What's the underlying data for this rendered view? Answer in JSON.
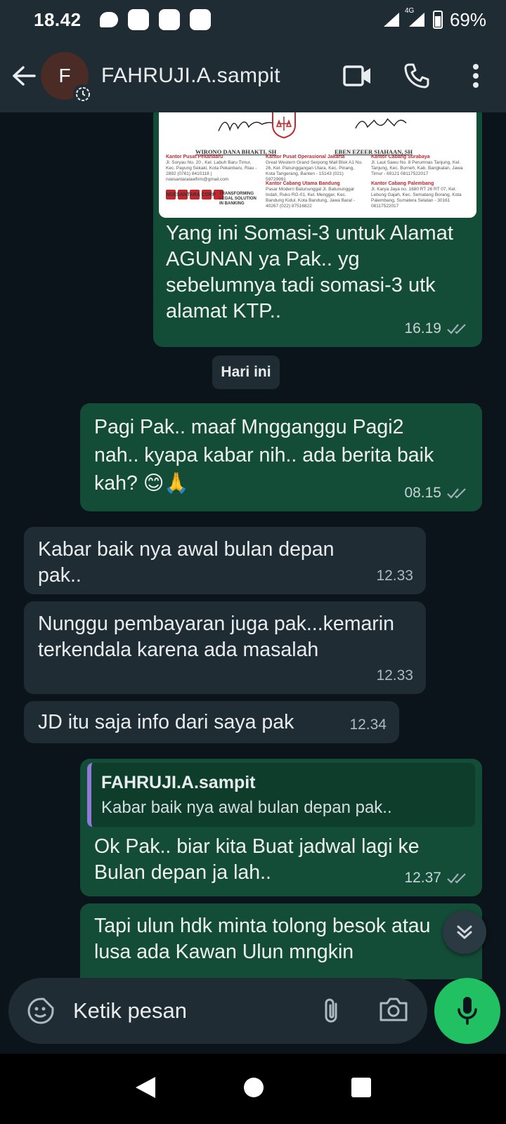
{
  "status": {
    "time": "18.42",
    "network": "4G",
    "battery": "69%"
  },
  "header": {
    "avatar_letter": "F",
    "contact_name": "FAHRUJI.A.sampit"
  },
  "letterhead": {
    "signer_left": "WIRONO DANA BHAKTI, SH",
    "signer_right": "EBEN EZEER SIAHAAN, SH",
    "office_1_title": "Kantor Pusat Pekanbaru",
    "office_1_text": "Jl. Soryau No. 20 , Kel. Labuh Baru Timur, Kec. Payung Sekaki, Kota Pekanbaru, Riau - 2892 (0761) 8410118 | noesantaralawfirm@gmail.com",
    "office_2_title": "Kantor Pusat Operasional Jakarta",
    "office_2_text": "Great Western Grand Serpong Mall Blok A1 No. 26, Kel. Panunggangan Utara, Kec. Pinang, Kota Tangerang, Banten - 15143 (021) 59729991",
    "office_3_title": "Kantor Cabang Surabaya",
    "office_3_text": "Jl. Laut Sawu No. 8 Perumnas Tanjung, Kel. Tanjung, Kec. Burneh, Kab. Bangkalan, Jawa Timur - 69121 08117522017",
    "office_4_title": "Kantor Cabang Utama Bandung",
    "office_4_text": "Pasar Modern Batununggal Jl. Batununggal Indah, Ruko RG-01, Kel. Mengger, Kec. Bandung Kidul, Kota Bandung, Jawa Barat - 40267 (022) 87516822",
    "office_5_title": "Kantor Cabang Palembang",
    "office_5_text": "Jl. Karya Jaya no. 1680 RT 26 RT 07, Kel. Lebung Gajah, Kec. Sematang Borang, Kota Palembang, Sumatera Selatan - 30161 08117522017",
    "corp": "NOESANTARA CORP",
    "tagline": "TRANSFORMING LEGAL SOLUTION IN BANKING"
  },
  "messages": [
    {
      "dir": "out",
      "text": "Yang ini Somasi-3 untuk Alamat AGUNAN ya Pak.. yg sebelumnya tadi somasi-3 utk alamat KTP..",
      "time": "16.19"
    },
    {
      "dir": "out",
      "text": "Pagi Pak.. maaf Mngganggu Pagi2 nah.. kyapa kabar nih.. ada berita baik kah? 😊🙏",
      "time": "08.15"
    },
    {
      "dir": "in",
      "text": "Kabar baik nya awal bulan depan pak..",
      "time": "12.33"
    },
    {
      "dir": "in",
      "text": "Nunggu pembayaran juga pak...kemarin terkendala karena ada masalah",
      "time": "12.33"
    },
    {
      "dir": "in",
      "text": "JD itu saja info dari saya pak",
      "time": "12.34"
    },
    {
      "dir": "out",
      "quote_name": "FAHRUJI.A.sampit",
      "quote_text": "Kabar baik nya awal bulan depan pak..",
      "text": "Ok Pak.. biar kita Buat jadwal lagi ke Bulan depan ja lah..",
      "time": "12.37"
    },
    {
      "dir": "out",
      "text": "Tapi ulun hdk minta tolong besok atau lusa ada Kawan Ulun mngkin",
      "time": ""
    }
  ],
  "date_chip": "Hari ini",
  "composer": {
    "placeholder": "Ketik pesan"
  },
  "colors": {
    "outgoing_bubble": "#134d37",
    "incoming_bubble": "#1f2c34",
    "accent_green": "#21c063",
    "background": "#0b141a"
  }
}
